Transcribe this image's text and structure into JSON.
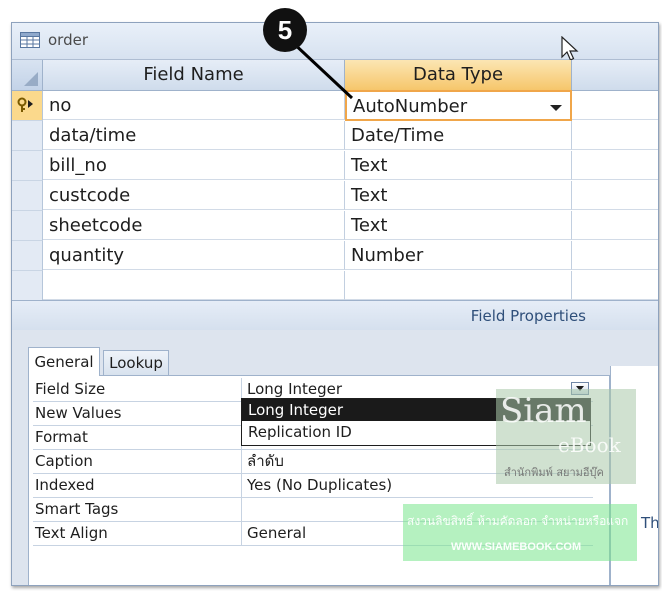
{
  "window": {
    "title": "order"
  },
  "grid": {
    "headers": {
      "field_name": "Field Name",
      "data_type": "Data Type"
    },
    "rows": [
      {
        "name": "no",
        "type": "AutoNumber",
        "primary_key": true
      },
      {
        "name": "data/time",
        "type": "Date/Time"
      },
      {
        "name": "bill_no",
        "type": "Text"
      },
      {
        "name": "custcode",
        "type": "Text"
      },
      {
        "name": "sheetcode",
        "type": "Text"
      },
      {
        "name": "quantity",
        "type": "Number"
      }
    ]
  },
  "field_properties": {
    "label": "Field Properties",
    "tabs": {
      "general": "General",
      "lookup": "Lookup"
    },
    "rows": [
      {
        "name": "Field Size",
        "value": "Long Integer"
      },
      {
        "name": "New Values",
        "value": ""
      },
      {
        "name": "Format",
        "value": ""
      },
      {
        "name": "Caption",
        "value": "ลำดับ"
      },
      {
        "name": "Indexed",
        "value": "Yes (No Duplicates)"
      },
      {
        "name": "Smart Tags",
        "value": ""
      },
      {
        "name": "Text Align",
        "value": "General"
      }
    ],
    "dropdown_options": [
      "Long Integer",
      "Replication ID"
    ],
    "help_text": "The"
  },
  "callout": {
    "number": "5"
  },
  "watermark": {
    "brand": "Siam",
    "brand_sub": "eBook",
    "thai_tag": "สำนักพิมพ์ สยามอีบุ๊ค",
    "banner_thai": "สงวนลิขสิทธิ์ ห้ามคัดลอก จำหน่ายหรือแจก",
    "url": "WWW.SIAMEBOOK.COM"
  },
  "colors": {
    "active_header": "#f6c66b",
    "active_border": "#f0a64a",
    "selection": "#1a1a1a"
  }
}
